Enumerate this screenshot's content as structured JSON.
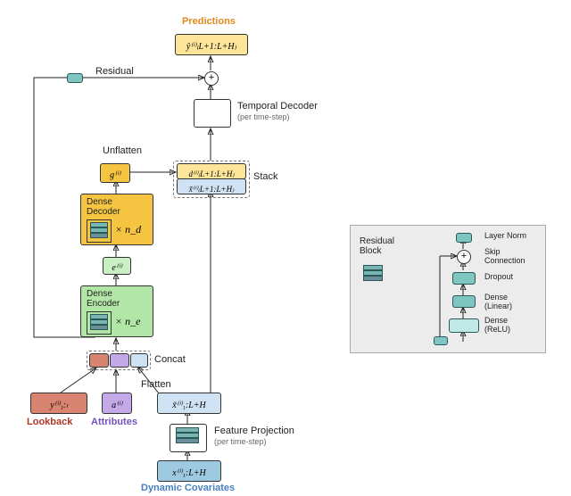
{
  "title": "Predictions",
  "pred_symbol": "ŷ⁽ⁱ⁾₍L+1:L+H₎",
  "residual_label": "Residual",
  "temporal_decoder": {
    "title": "Temporal Decoder",
    "sub": "(per time-step)"
  },
  "unflatten": "Unflatten",
  "g_symbol": "g⁽ⁱ⁾",
  "d_symbol": "d⁽ⁱ⁾₍L+1:L+H₎",
  "xtilde_symbol": "x̃⁽ⁱ⁾₍L+1:L+H₎",
  "stack": "Stack",
  "dense_decoder": {
    "title": "Dense\nDecoder",
    "count": "× n_d"
  },
  "e_symbol": "e⁽ⁱ⁾",
  "dense_encoder": {
    "title": "Dense\nEncoder",
    "count": "× n_e"
  },
  "concat": "Concat",
  "flatten": "Flatten",
  "y_symbol": "y⁽ⁱ⁾₁:ₗ",
  "a_symbol": "a⁽ⁱ⁾",
  "xt_symbol": "x̃⁽ⁱ⁾₁:L+H",
  "x_symbol": "x⁽ⁱ⁾₁:L+H",
  "lookback": "Lookback",
  "attributes": "Attributes",
  "dyn_cov": "Dynamic Covariates",
  "feat_proj": {
    "title": "Feature Projection",
    "sub": "(per time-step)"
  },
  "legend": {
    "title": "Residual\nBlock",
    "layer_norm": "Layer Norm",
    "skip": "Skip\nConnection",
    "dropout": "Dropout",
    "dense_linear": "Dense\n(Linear)",
    "dense_relu": "Dense\n(ReLU)"
  }
}
